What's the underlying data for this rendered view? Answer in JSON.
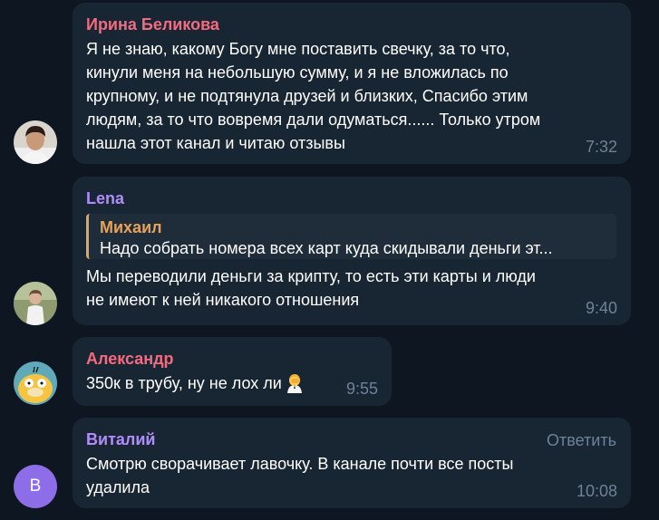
{
  "messages": [
    {
      "author": "Ирина Беликова",
      "author_color": "#f36b7f",
      "text": "Я не знаю, какому Богу мне поставить свечку, за то что,\nкинули меня на небольшую сумму, и я не вложилась по\nкрупному, и не подтянула друзей и близких, Спасибо этим\nлюдям, за то что вовремя дали одуматься...... Только утром\nнашла этот канал и читаю отзывы",
      "time": "7:32",
      "avatar": "user-photo"
    },
    {
      "author": "Lena",
      "author_color": "#b18dfc",
      "reply": {
        "author": "Михаил",
        "text": "Надо собрать номера всех карт куда скидывали деньги эт..."
      },
      "text": "Мы переводили деньги за крипту, то есть эти карты и люди\nне имеют к ней никакого отношения",
      "time": "9:40",
      "avatar": "user-photo"
    },
    {
      "author": "Александр",
      "author_color": "#f36b7f",
      "text": "350к в трубу, ну не лох ли",
      "emoji": "facepalm-emoji",
      "time": "9:55",
      "avatar": "psyduck-picture"
    },
    {
      "author": "Виталий",
      "author_color": "#b18dfc",
      "text": "Смотрю сворачивает лавочку. В канале почти все посты\nудалила",
      "time": "10:08",
      "reply_action": "Ответить",
      "avatar_letter": "В",
      "avatar_color": "#8e6ee8"
    }
  ],
  "colors": {
    "background": "#0e1621",
    "bubble": "#182533",
    "text": "#ffffff",
    "time": "#6e8297",
    "quote_bar": "#e7a258"
  }
}
